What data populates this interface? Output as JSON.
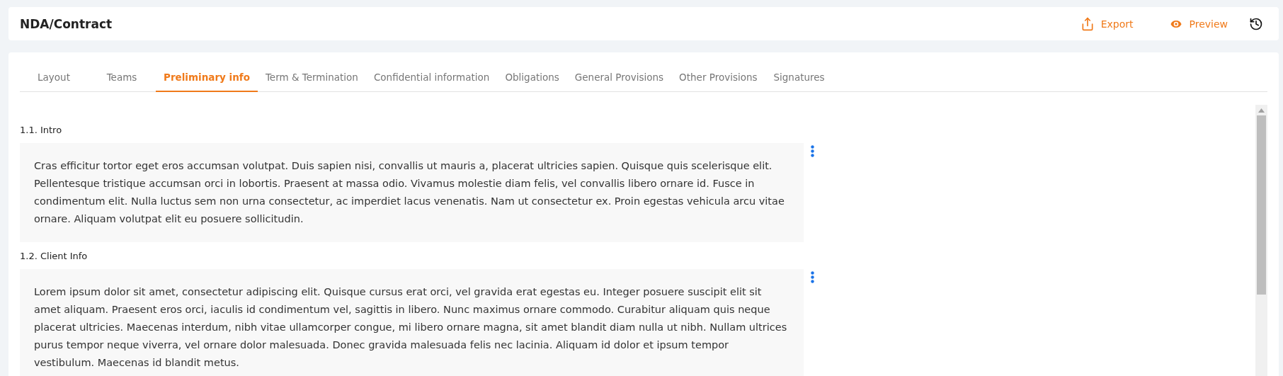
{
  "header": {
    "title": "NDA/Contract",
    "actions": [
      {
        "kind": "export",
        "label": "Export"
      },
      {
        "kind": "preview",
        "label": "Preview"
      },
      {
        "kind": "history"
      }
    ]
  },
  "tabs": [
    {
      "label": "Layout",
      "selected": false
    },
    {
      "label": "Teams",
      "selected": false
    },
    {
      "label": "Preliminary info",
      "selected": true
    },
    {
      "label": "Term & Termination",
      "selected": false
    },
    {
      "label": "Confidential information",
      "selected": false
    },
    {
      "label": "Obligations",
      "selected": false
    },
    {
      "label": "General Provisions",
      "selected": false
    },
    {
      "label": "Other Provisions",
      "selected": false
    },
    {
      "label": "Signatures",
      "selected": false
    }
  ],
  "sections": [
    {
      "heading": "1.1. Intro",
      "text": "Cras efficitur tortor eget eros accumsan volutpat. Duis sapien nisi, convallis ut mauris a, placerat ultricies sapien. Quisque quis scelerisque elit. Pellentesque tristique accumsan orci in lobortis. Praesent at massa odio. Vivamus molestie diam felis, vel convallis libero ornare id. Fusce in condimentum elit. Nulla luctus sem non urna consectetur, ac imperdiet lacus venenatis. Nam ut consectetur ex. Proin egestas vehicula arcu vitae ornare. Aliquam volutpat elit eu posuere sollicitudin."
    },
    {
      "heading": "1.2. Client Info",
      "text": "Lorem ipsum dolor sit amet, consectetur adipiscing elit. Quisque cursus erat orci, vel gravida erat egestas eu. Integer posuere suscipit elit sit amet aliquam. Praesent eros orci, iaculis id condimentum vel, sagittis in libero. Nunc maximus ornare commodo. Curabitur aliquam quis neque placerat ultricies. Maecenas interdum, nibh vitae ullamcorper congue, mi libero ornare magna, sit amet blandit diam nulla ut nibh. Nullam ultrices purus tempor neque viverra, vel ornare dolor malesuada. Donec gravida malesuada felis nec lacinia. Aliquam id dolor et ipsum tempor vestibulum. Maecenas id blandit metus."
    }
  ]
}
